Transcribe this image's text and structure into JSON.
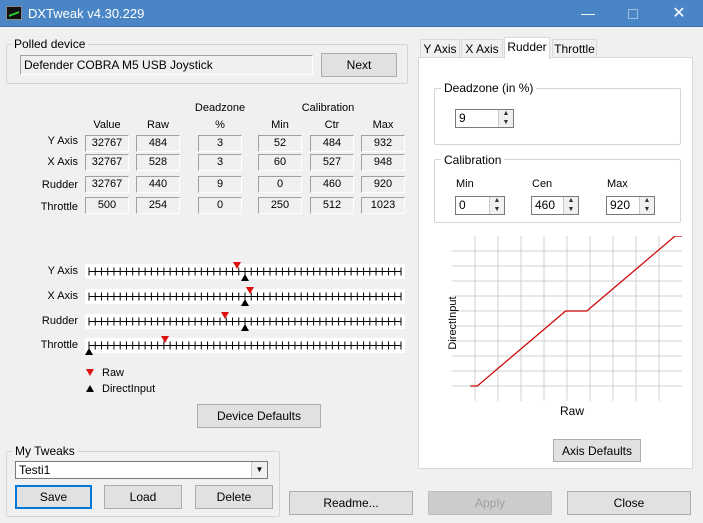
{
  "window": {
    "title": "DXTweak v4.30.229",
    "minimize": "—",
    "close": "✕"
  },
  "polled": {
    "group_label": "Polled device",
    "device_name": "Defender COBRA M5 USB Joystick",
    "next_label": "Next"
  },
  "table": {
    "headers": {
      "value": "Value",
      "raw": "Raw",
      "deadzone": "Deadzone",
      "deadzone_unit": "%",
      "calibration": "Calibration",
      "min": "Min",
      "ctr": "Ctr",
      "max": "Max"
    },
    "rows": [
      {
        "name": "Y Axis",
        "value": "32767",
        "raw": "484",
        "deadzone": "3",
        "min": "52",
        "ctr": "484",
        "max": "932"
      },
      {
        "name": "X Axis",
        "value": "32767",
        "raw": "528",
        "deadzone": "3",
        "min": "60",
        "ctr": "527",
        "max": "948"
      },
      {
        "name": "Rudder",
        "value": "32767",
        "raw": "440",
        "deadzone": "9",
        "min": "0",
        "ctr": "460",
        "max": "920"
      },
      {
        "name": "Throttle",
        "value": "500",
        "raw": "254",
        "deadzone": "0",
        "min": "250",
        "ctr": "512",
        "max": "1023"
      }
    ]
  },
  "sliders": {
    "rows": [
      {
        "name": "Y Axis",
        "raw_fraction": 0.475,
        "di_fraction": 0.5
      },
      {
        "name": "X Axis",
        "raw_fraction": 0.515,
        "di_fraction": 0.5
      },
      {
        "name": "Rudder",
        "raw_fraction": 0.435,
        "di_fraction": 0.5
      },
      {
        "name": "Throttle",
        "raw_fraction": 0.245,
        "di_fraction": 0.0
      }
    ],
    "legend_raw": "Raw",
    "legend_di": "DirectInput",
    "raw_color": "#dd1010",
    "di_color": "#000000"
  },
  "device_defaults_label": "Device Defaults",
  "my_tweaks": {
    "group_label": "My Tweaks",
    "selected": "Testi1",
    "save": "Save",
    "load": "Load",
    "delete": "Delete"
  },
  "tabs": [
    {
      "label": "Y Axis"
    },
    {
      "label": "X Axis"
    },
    {
      "label": "Rudder"
    },
    {
      "label": "Throttle"
    }
  ],
  "active_tab": "Rudder",
  "rudder": {
    "deadzone_label": "Deadzone (in %)",
    "deadzone_value": "9",
    "calibration_label": "Calibration",
    "min_label": "Min",
    "cen_label": "Cen",
    "max_label": "Max",
    "min_value": "0",
    "cen_value": "460",
    "max_value": "920",
    "chart_xlabel": "Raw",
    "chart_ylabel": "DirectInput",
    "axis_defaults_label": "Axis Defaults"
  },
  "chart_data": {
    "type": "line",
    "title": "",
    "xlabel": "Raw",
    "ylabel": "DirectInput",
    "x": [
      0,
      30,
      414,
      506,
      890,
      920
    ],
    "series": [
      {
        "values": [
          0,
          0,
          50,
          50,
          100,
          100
        ]
      }
    ],
    "xlim": [
      -80,
      920
    ],
    "ylim": [
      -10,
      100
    ],
    "grid": true,
    "line_color": "#cc0000"
  },
  "footer": {
    "readme": "Readme...",
    "apply": "Apply",
    "close": "Close"
  }
}
